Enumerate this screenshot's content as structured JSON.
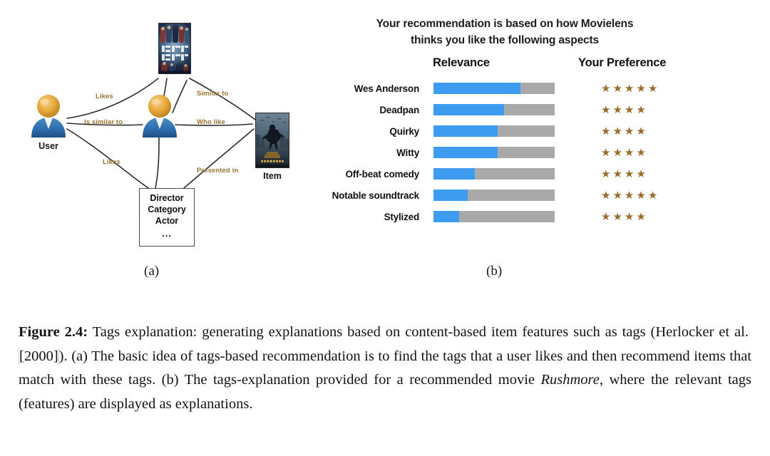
{
  "figure": {
    "sublabel_a": "(a)",
    "sublabel_b": "(b)"
  },
  "panel_a": {
    "name": "tags-based-recommendation-graph",
    "nodes": [
      {
        "id": "user",
        "type": "avatar",
        "caption": "User"
      },
      {
        "id": "similar-user",
        "type": "avatar",
        "caption": ""
      },
      {
        "id": "liked-movie",
        "type": "poster",
        "caption": "",
        "poster_title": "Justice League"
      },
      {
        "id": "item",
        "type": "poster",
        "caption": "Item",
        "poster_title": "Black Panther"
      },
      {
        "id": "features",
        "type": "box",
        "caption": ""
      }
    ],
    "feature_box": {
      "line1": "Director",
      "line2": "Category",
      "line3": "Actor",
      "dots": "..."
    },
    "edge_labels": {
      "likes_top": "Likes",
      "similar_to": "Similar to",
      "is_similar_to": "Is similar to",
      "who_like": "Who like",
      "likes_bottom": "Likes",
      "presented_in": "Presented in"
    },
    "node_captions": {
      "user": "User",
      "item": "Item"
    },
    "colors": {
      "edge_label": "#9b7330",
      "edge_line": "#2b2b2b",
      "avatar_head": "#e8a93a",
      "avatar_body": "#2f6fb0"
    }
  },
  "panel_b": {
    "title_line1": "Your recommendation is based on how Movielens",
    "title_line2": "thinks you like the following aspects",
    "columns": {
      "relevance": "Relevance",
      "preference": "Your Preference"
    },
    "colors": {
      "header_accent": "#e8523f",
      "bar_fill": "#3d9bf0",
      "bar_track": "#a9a9a9",
      "star": "#9a6b2a"
    },
    "star_glyph": "★"
  },
  "chart_data": {
    "type": "bar",
    "title": "Your recommendation is based on how Movielens thinks you like the following aspects",
    "subtitle": "",
    "xlabel": "",
    "ylabel": "",
    "orientation": "horizontal",
    "stacked": true,
    "grid": false,
    "legend_position": "top",
    "xlim": [
      0,
      100
    ],
    "categories": [
      "Wes Anderson",
      "Deadpan",
      "Quirky",
      "Witty",
      "Off-beat comedy",
      "Notable soundtrack",
      "Stylized"
    ],
    "series": [
      {
        "name": "Relevance",
        "unit": "percent",
        "values": [
          72,
          58,
          53,
          53,
          34,
          28,
          21
        ]
      },
      {
        "name": "Your Preference",
        "unit": "stars",
        "max": 5,
        "values": [
          5,
          4,
          4,
          4,
          4,
          5,
          4
        ]
      }
    ],
    "rows": [
      {
        "aspect": "Wes Anderson",
        "relevance_pct": 72,
        "stars": 5
      },
      {
        "aspect": "Deadpan",
        "relevance_pct": 58,
        "stars": 4
      },
      {
        "aspect": "Quirky",
        "relevance_pct": 53,
        "stars": 4
      },
      {
        "aspect": "Witty",
        "relevance_pct": 53,
        "stars": 4
      },
      {
        "aspect": "Off-beat comedy",
        "relevance_pct": 34,
        "stars": 4
      },
      {
        "aspect": "Notable soundtrack",
        "relevance_pct": 28,
        "stars": 5
      },
      {
        "aspect": "Stylized",
        "relevance_pct": 21,
        "stars": 4
      }
    ]
  },
  "caption": {
    "figure_number": "Figure 2.4:",
    "text_part1": " Tags explanation: generating explanations based on content-based item features such as tags (Herlocker et al. ",
    "citation": "[2000]",
    "text_part2": "). (a) The basic idea of tags-based recommendation is to find the tags that a user likes and then recommend items that match with these tags. (b) The tags-explanation provided for a recommended movie ",
    "movie_title": "Rushmore",
    "text_part3": ", where the relevant tags (features) are displayed as explanations."
  }
}
